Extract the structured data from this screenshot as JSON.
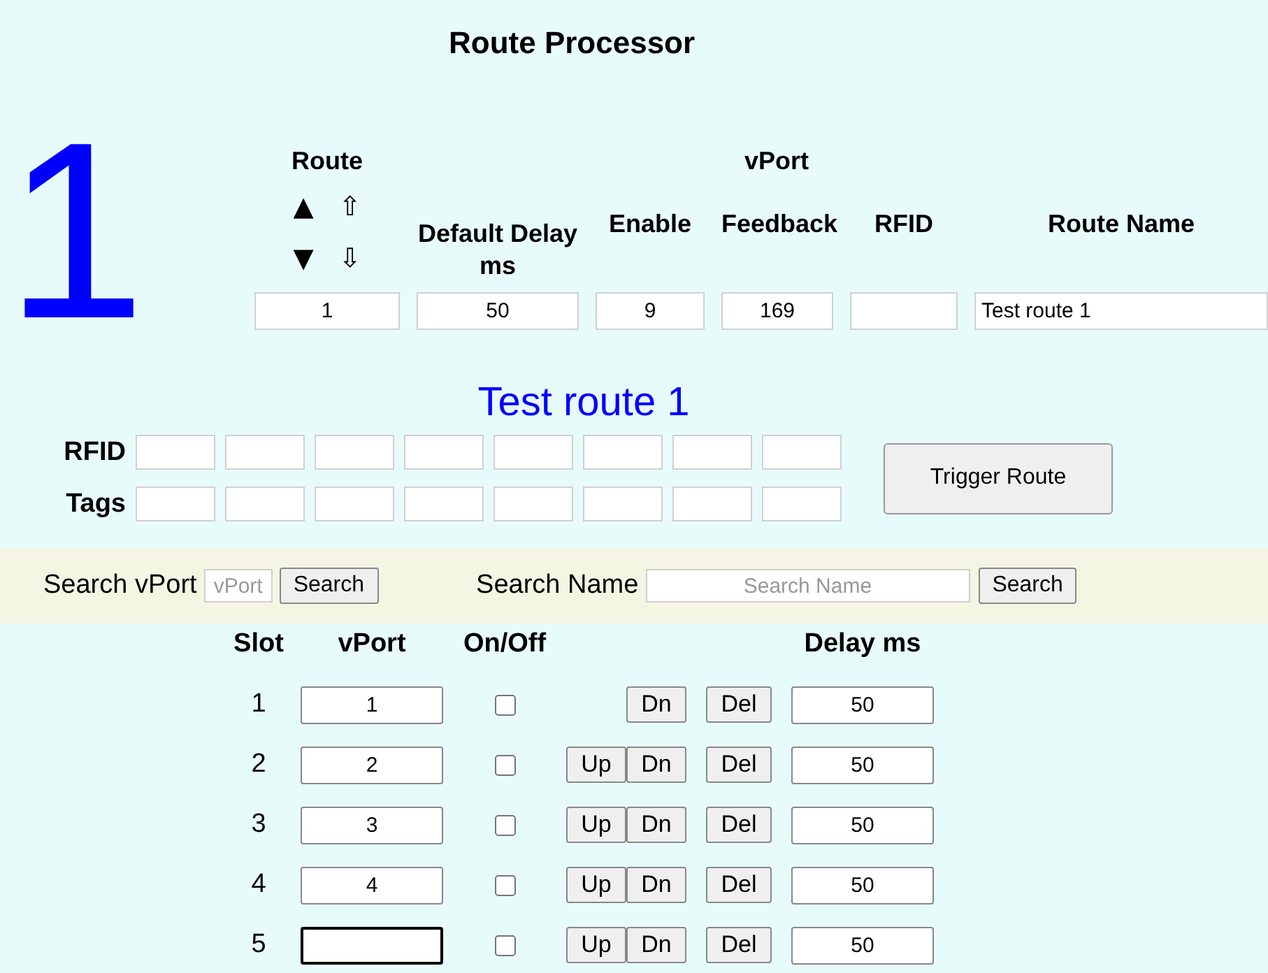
{
  "title": "Route Processor",
  "route_number": "1",
  "route_header": {
    "route_label": "Route",
    "vport_label": "vPort",
    "arrows": [
      {
        "solid": "▲",
        "outline": "⇧"
      },
      {
        "solid": "▼",
        "outline": "⇩"
      }
    ],
    "columns": [
      {
        "kind": "route",
        "value": "1"
      },
      {
        "kind": "number",
        "label": "Default Delay ms",
        "value": "50"
      },
      {
        "kind": "number",
        "label": "Enable",
        "value": "9"
      },
      {
        "kind": "number",
        "label": "Feedback",
        "value": "169"
      },
      {
        "kind": "number",
        "label": "RFID"
      },
      {
        "kind": "text",
        "label": "Route Name",
        "value": "Test route 1"
      }
    ]
  },
  "route_name_display": "Test route 1",
  "tag_rows": [
    {
      "label": "RFID"
    },
    {
      "label": "Tags"
    }
  ],
  "trigger_button": "Trigger Route",
  "search_bar": {
    "vport_label": "Search vPort",
    "vport_placeholder": "vPort",
    "vport_button": "Search",
    "name_label": "Search Name",
    "name_placeholder": "Search Name",
    "name_button": "Search"
  },
  "slots": {
    "columns": [
      "Slot",
      "vPort",
      "On/Off",
      "Delay ms"
    ],
    "rows": [
      {
        "slot": "1",
        "vport": "1",
        "on": false,
        "focused": false,
        "down": "Dn",
        "delete": "Del",
        "delay": "50"
      },
      {
        "slot": "2",
        "vport": "2",
        "on": false,
        "focused": false,
        "up": "Up",
        "down": "Dn",
        "delete": "Del",
        "delay": "50"
      },
      {
        "slot": "3",
        "vport": "3",
        "on": false,
        "focused": false,
        "up": "Up",
        "down": "Dn",
        "delete": "Del",
        "delay": "50"
      },
      {
        "slot": "4",
        "vport": "4",
        "on": false,
        "focused": false,
        "up": "Up",
        "down": "Dn",
        "delete": "Del",
        "delay": "50"
      },
      {
        "slot": "5",
        "vport": "",
        "on": false,
        "focused": true,
        "up": "Up",
        "down": "Dn",
        "delete": "Del",
        "delay": "50"
      }
    ]
  }
}
